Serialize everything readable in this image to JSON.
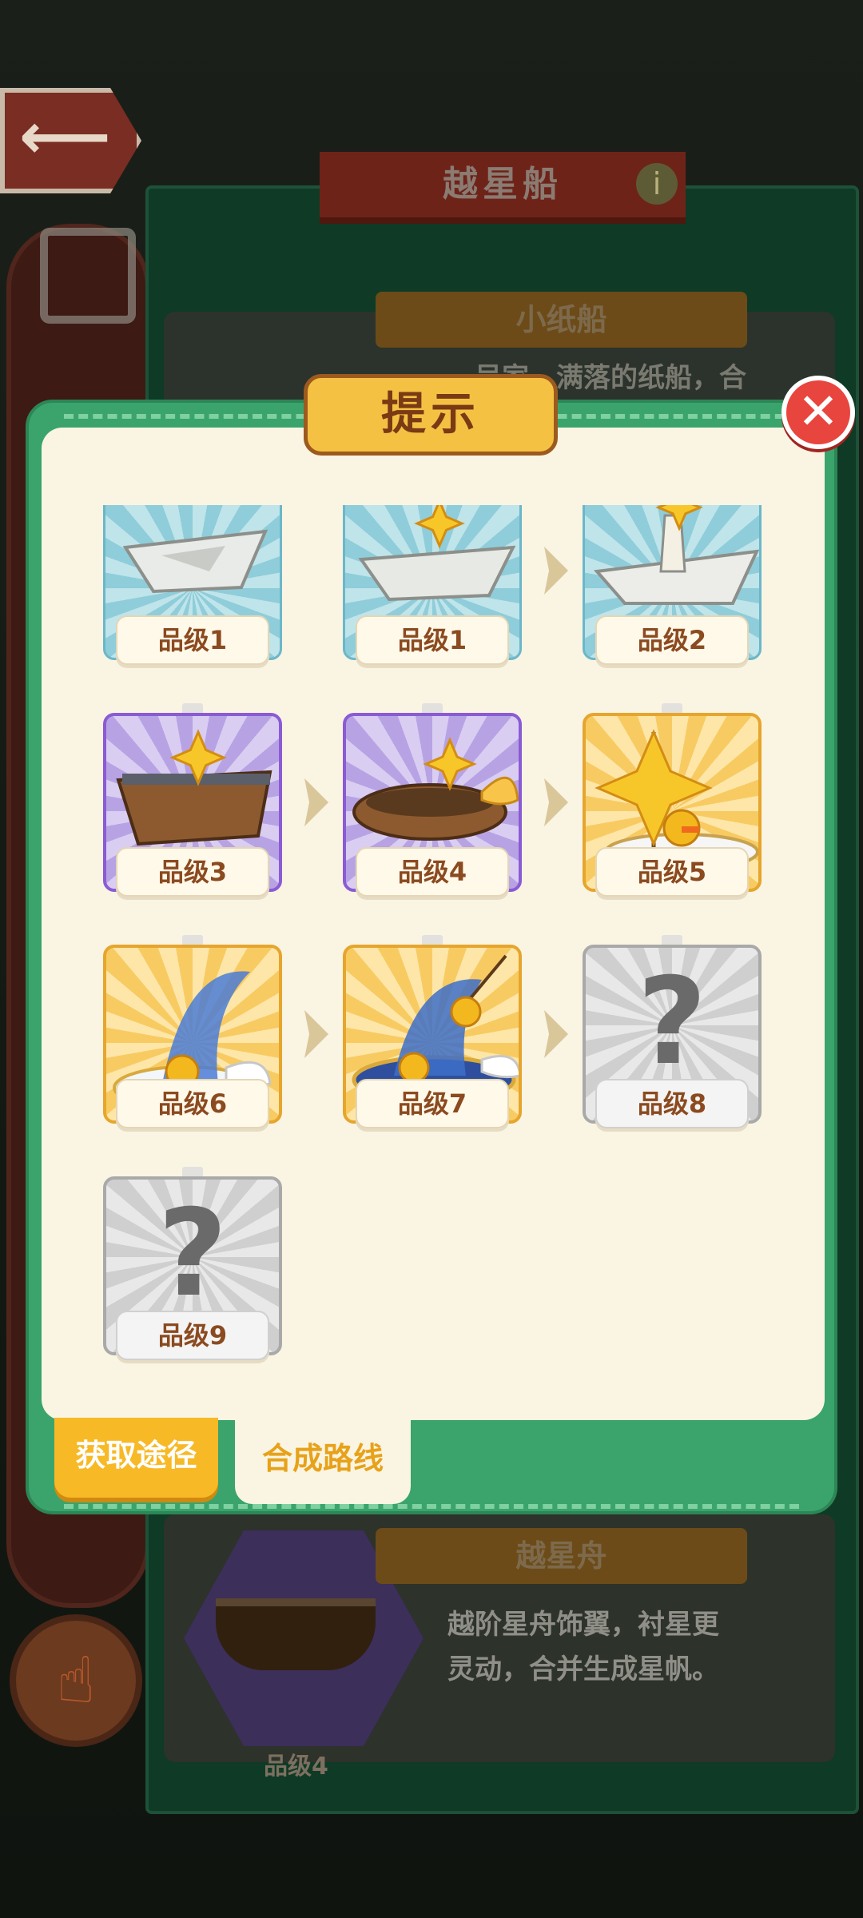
{
  "background": {
    "panel_title": "越星船",
    "card_top": {
      "name": "小纸船",
      "desc": "…吴家…满落的纸船，合"
    },
    "card_bottom": {
      "name": "越星舟",
      "desc_line1": "越阶星舟饰翼，衬星更",
      "desc_line2": "灵动，合并生成星帆。",
      "grade": "品级4"
    },
    "info_icon": "i"
  },
  "modal": {
    "title": "提示",
    "close_glyph": "✕",
    "items": [
      {
        "grade": "品级1",
        "rarity": "blue",
        "icon": "paper-boat-icon"
      },
      {
        "grade": "品级1",
        "rarity": "blue",
        "icon": "paper-boat-star-icon"
      },
      {
        "grade": "品级2",
        "rarity": "blue",
        "icon": "paper-boat-sail-icon"
      },
      {
        "grade": "品级3",
        "rarity": "purple",
        "icon": "wooden-boat-icon"
      },
      {
        "grade": "品级4",
        "rarity": "purple",
        "icon": "winged-boat-icon"
      },
      {
        "grade": "品级5",
        "rarity": "gold",
        "icon": "star-sail-boat-icon"
      },
      {
        "grade": "品级6",
        "rarity": "gold",
        "icon": "rainbow-wing-boat-icon"
      },
      {
        "grade": "品级7",
        "rarity": "gold",
        "icon": "fishing-wing-boat-icon"
      },
      {
        "grade": "品级8",
        "rarity": "grey",
        "icon": "unknown-question-icon"
      },
      {
        "grade": "品级9",
        "rarity": "grey",
        "icon": "unknown-question-icon"
      }
    ],
    "unknown_glyph": "?",
    "tabs": {
      "obtain": "获取途径",
      "route": "合成路线"
    }
  },
  "colors": {
    "frame": "#3aa46c",
    "body": "#faf4e3",
    "title_plate": "#f5c143",
    "close": "#e8453e",
    "tab_active": "#f7b926"
  }
}
